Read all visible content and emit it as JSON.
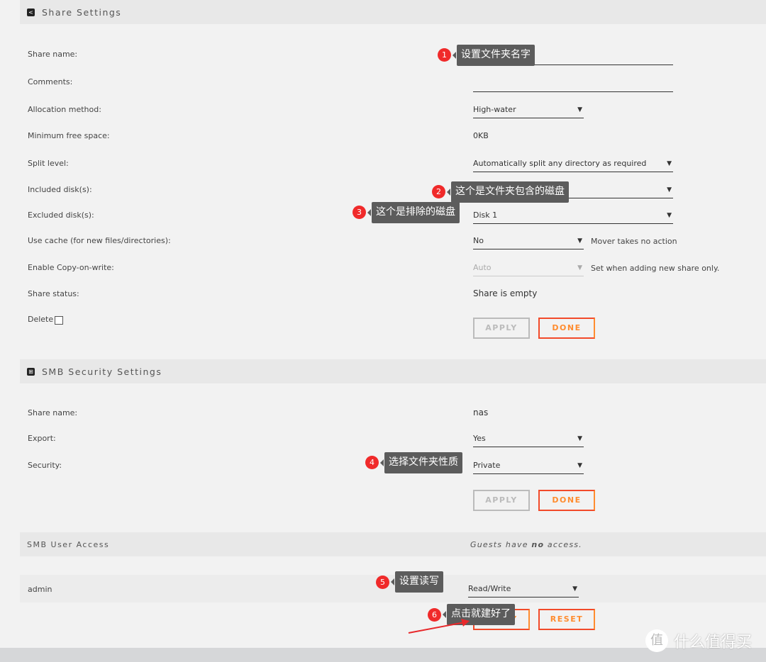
{
  "share_settings": {
    "title": "Share Settings",
    "icon": "share-icon",
    "fields": [
      {
        "label": "Share name:",
        "value": ""
      },
      {
        "label": "Comments:",
        "value": ""
      },
      {
        "label": "Allocation method:",
        "value": "High-water"
      },
      {
        "label": "Minimum free space:",
        "value": "0KB"
      },
      {
        "label": "Split level:",
        "value": "Automatically split any directory as required"
      },
      {
        "label": "Included disk(s):",
        "value": ""
      },
      {
        "label": "Excluded disk(s):",
        "value": "Disk 1"
      },
      {
        "label": "Use cache (for new files/directories):",
        "value": "No",
        "note": "Mover takes no action"
      },
      {
        "label": "Enable Copy-on-write:",
        "value": "Auto",
        "note": "Set when adding new share only."
      },
      {
        "label": "Share status:",
        "value": "Share is empty"
      },
      {
        "label": "Delete"
      }
    ],
    "apply": "APPLY",
    "done": "DONE"
  },
  "smb_security": {
    "title": "SMB Security Settings",
    "icon": "windows-icon",
    "fields": [
      {
        "label": "Share name:",
        "value": "nas"
      },
      {
        "label": "Export:",
        "value": "Yes"
      },
      {
        "label": "Security:",
        "value": "Private"
      }
    ],
    "apply": "APPLY",
    "done": "DONE"
  },
  "smb_user_access": {
    "title": "SMB User Access",
    "note_pre": "Guests have ",
    "note_bold": "no",
    "note_post": " access.",
    "users": [
      {
        "name": "admin",
        "access": "Read/Write"
      }
    ],
    "apply": "APPLY",
    "reset": "RESET"
  },
  "annotations": [
    {
      "n": "1",
      "text": "设置文件夹名字"
    },
    {
      "n": "2",
      "text": "这个是文件夹包含的磁盘"
    },
    {
      "n": "3",
      "text": "这个是排除的磁盘"
    },
    {
      "n": "4",
      "text": "选择文件夹性质"
    },
    {
      "n": "5",
      "text": "设置读写"
    },
    {
      "n": "6",
      "text": "点击就建好了"
    }
  ],
  "watermark": "什么值得买",
  "colors": {
    "accent": "#ff8c2f",
    "accent2": "#f24a2a",
    "badge": "#f02a2a"
  }
}
